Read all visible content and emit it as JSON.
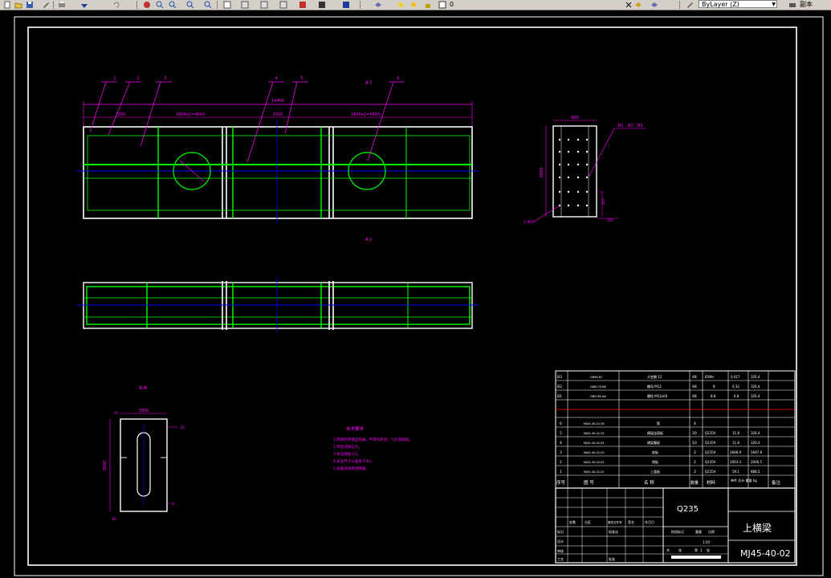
{
  "toolbar": {
    "layer_combo_value": "ByLayer (Z)",
    "layer_number": "0",
    "right_button_label": "副本"
  },
  "drawing": {
    "view_labels": {
      "section_top": "A↑",
      "section_bottom": "A↓",
      "section_view": "A-A"
    },
    "balloons": [
      "1",
      "2",
      "3",
      "4",
      "5",
      "6"
    ],
    "small_view_balloons": [
      "B1",
      "B2",
      "B3"
    ],
    "dims_top": {
      "overall": "14400",
      "left_seg": "1200",
      "seg_a": "1800x2=4500",
      "center": "3310",
      "seg_b": "1800x2=4500"
    },
    "section_dims": {
      "width": "1800",
      "height": "3600",
      "right": "20",
      "bottom": "8",
      "left_small": "10"
    },
    "small_view_dims": {
      "width": "980",
      "height": "2800",
      "hole": "4-Φ20",
      "right_a": "400",
      "right_b": "100"
    },
    "tech_title": "技术要求",
    "tech_lines": [
      "1.焊接时焊缝应饱满，不得有夹渣、气孔等缺陷。",
      "2.焊后消除应力。",
      "3.未注倒角 C2。",
      "4.未注尺寸公差按 IT12。",
      "5.表面涂防锈漆两遍。"
    ]
  },
  "bom": {
    "rows": [
      {
        "no": "B3",
        "code": "GB96-87",
        "name": "大垫圈 12",
        "qty": "48",
        "mat": "65Mn",
        "unit": "0.017",
        "total": "326.4"
      },
      {
        "no": "B2",
        "code": "GB6170-86",
        "name": "螺母 M12",
        "qty": "48",
        "mat": "8",
        "unit": "0.32",
        "total": "326.4"
      },
      {
        "no": "B1",
        "code": "GB5782-86",
        "name": "螺栓 M12x60",
        "qty": "48",
        "mat": "8.8",
        "unit": "6.8",
        "total": "326.4"
      },
      {
        "no": "",
        "code": "",
        "name": "",
        "qty": "",
        "mat": "",
        "unit": "",
        "total": ""
      },
      {
        "no": "6",
        "code": "MJ45-40-02-06",
        "name": "筋",
        "qty": "4",
        "mat": "",
        "unit": "",
        "total": ""
      },
      {
        "no": "5",
        "code": "MJ45-40-02-05",
        "name": "横梁连接板",
        "qty": "20",
        "mat": "Q235A",
        "unit": "11.8",
        "total": "326.4"
      },
      {
        "no": "4",
        "code": "MJ45-40-02-04",
        "name": "横梁腹板",
        "qty": "10",
        "mat": "Q235A",
        "unit": "11.8",
        "total": "326.4"
      },
      {
        "no": "3",
        "code": "MJ45-40-02-03",
        "name": "底板",
        "qty": "2",
        "mat": "Q235A",
        "unit": "2848.9",
        "total": "5697.8"
      },
      {
        "no": "2",
        "code": "MJ45-40-02-02",
        "name": "侧板",
        "qty": "2",
        "mat": "Q235A",
        "unit": "1003.3",
        "total": "2006.5"
      },
      {
        "no": "1",
        "code": "MJ45-40-02-01",
        "name": "上盖板",
        "qty": "2",
        "mat": "Q235A",
        "unit": "59.1",
        "total": "888.5"
      }
    ],
    "header": {
      "no": "序号",
      "code": "图 号",
      "name": "名 称",
      "qty": "数量",
      "mat": "材料",
      "weight": "单件 总计 重量 kg",
      "remark": "备注"
    }
  },
  "titleblock": {
    "material": "Q235",
    "part_name": "上横梁",
    "drawing_no": "MJ45-40-02",
    "scale": "1:50",
    "sheet": "1",
    "labels": {
      "design": "设计",
      "check": "审核",
      "process": "工艺",
      "approve": "批准",
      "mark": "标记",
      "count": "处数",
      "zone": "分区",
      "change": "更改文件号",
      "sign": "签名",
      "date": "年月日",
      "std": "标准化",
      "stage": "阶段标记",
      "weight": "重量",
      "ratio": "比例",
      "total": "共",
      "sheet_lbl": "张",
      "of": "第"
    }
  }
}
